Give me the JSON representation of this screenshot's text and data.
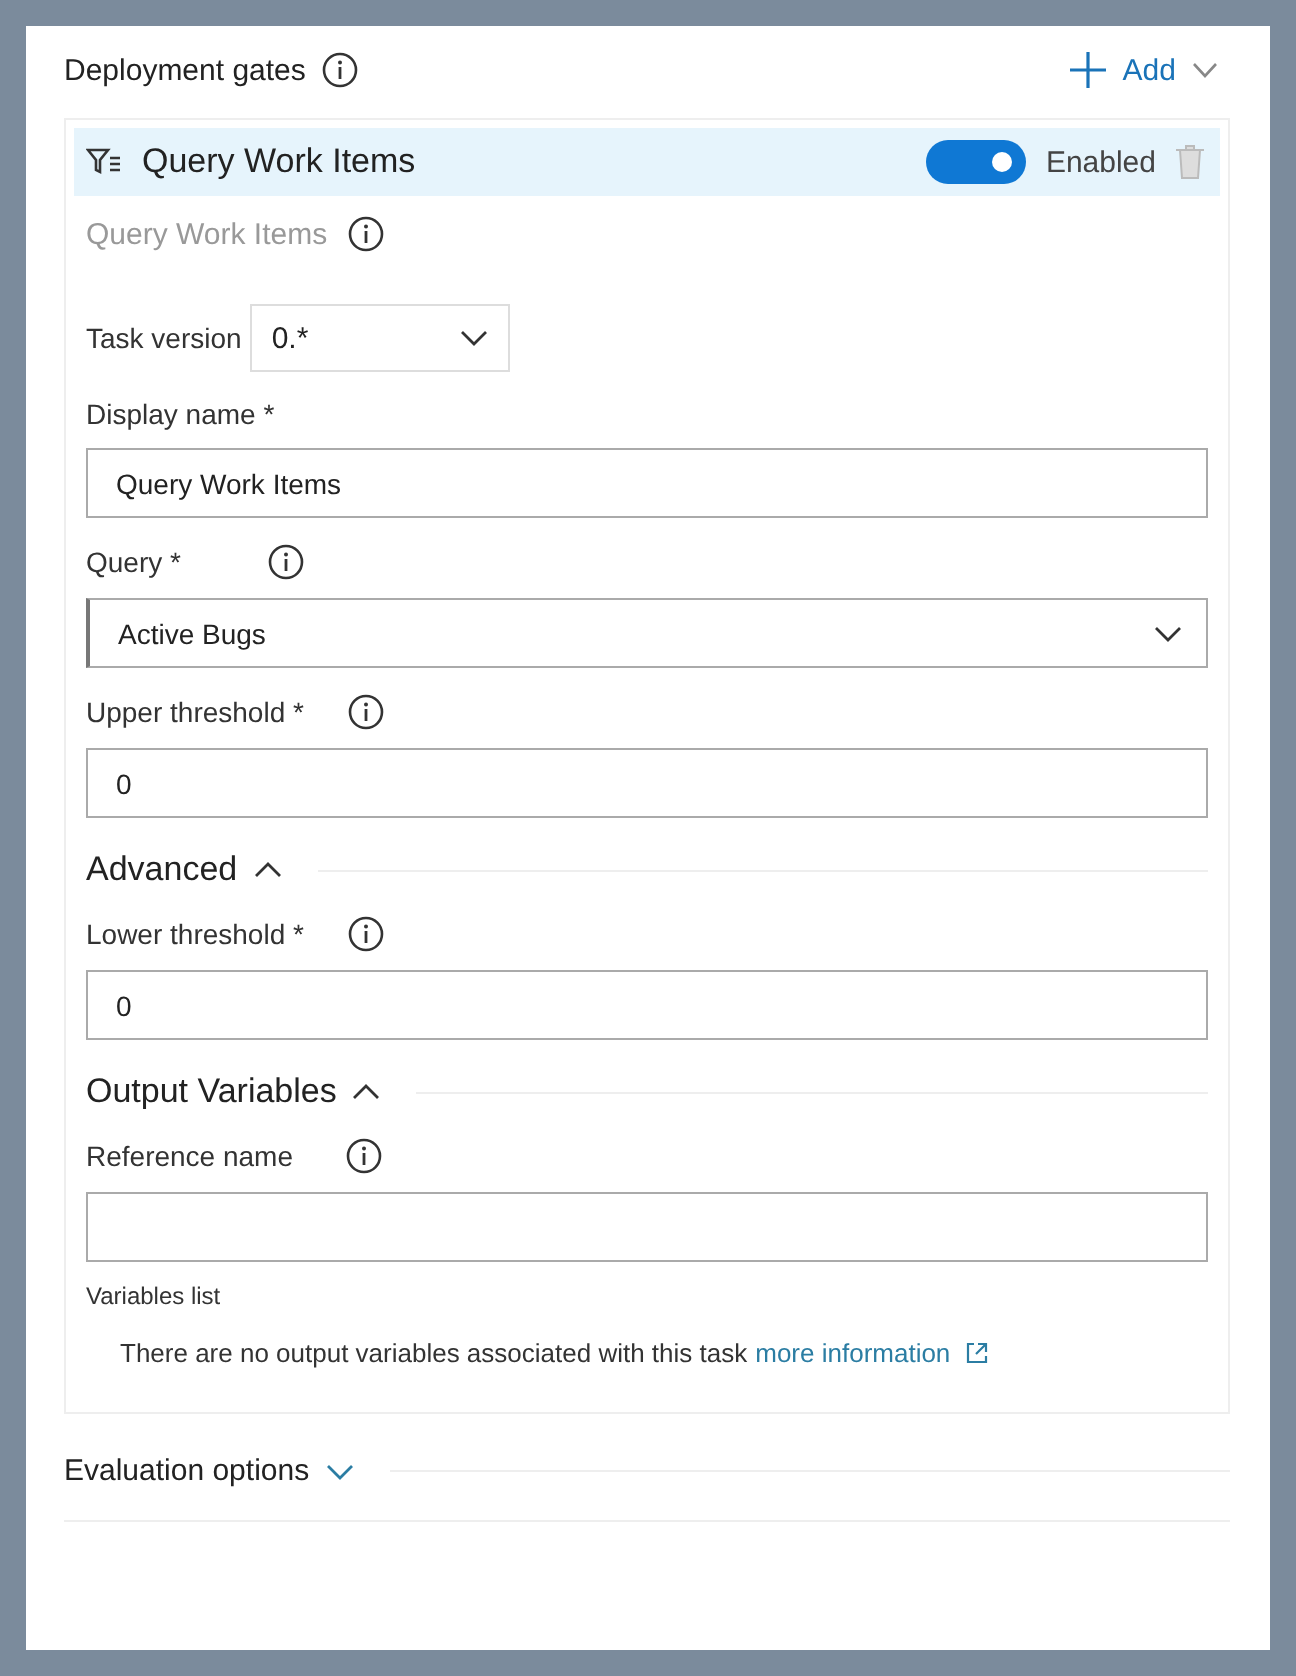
{
  "header": {
    "title": "Deployment gates",
    "add": "Add"
  },
  "gate": {
    "title": "Query Work Items",
    "enabled": true,
    "enabled_label": "Enabled",
    "subtitle": "Query Work Items"
  },
  "task_version": {
    "label": "Task version",
    "value": "0.*"
  },
  "items": [
    {
      "kind": "text",
      "label": "Display name *",
      "info": false,
      "value": "Query Work Items"
    },
    {
      "kind": "select",
      "label": "Query *",
      "info": true,
      "value": "Active Bugs"
    },
    {
      "kind": "text",
      "label": "Upper threshold *",
      "info": true,
      "value": "0"
    },
    {
      "kind": "section",
      "label": "Advanced",
      "expanded": true
    },
    {
      "kind": "text",
      "label": "Lower threshold *",
      "info": true,
      "value": "0"
    },
    {
      "kind": "section",
      "label": "Output Variables",
      "expanded": true
    },
    {
      "kind": "text",
      "label": "Reference name",
      "info": true
    }
  ],
  "variables_list": {
    "label": "Variables list",
    "message": "There are no output variables associated with this task",
    "link": "more information"
  },
  "evaluation": {
    "label": "Evaluation options",
    "expanded": false
  }
}
